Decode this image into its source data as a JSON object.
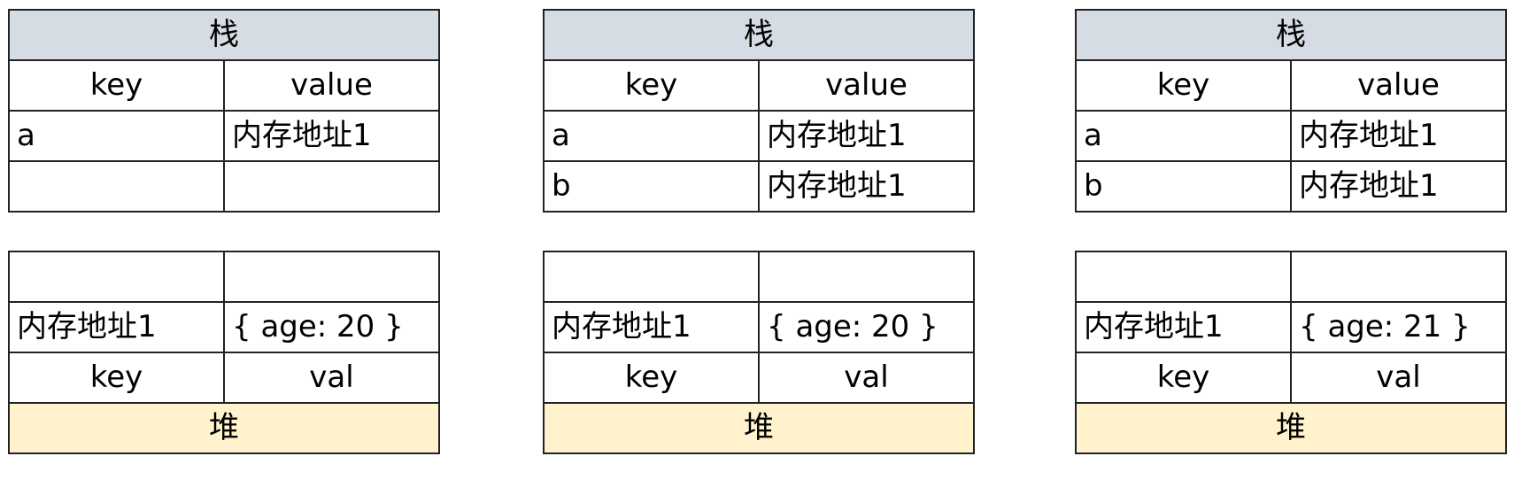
{
  "panels": [
    {
      "stack": {
        "title": "栈",
        "headers": [
          "key",
          "value"
        ],
        "rows": [
          [
            "a",
            "内存地址1"
          ],
          [
            "",
            ""
          ]
        ]
      },
      "heap": {
        "title": "堆",
        "headers": [
          "key",
          "val"
        ],
        "rows": [
          [
            "",
            ""
          ],
          [
            "内存地址1",
            "{ age: 20 }"
          ]
        ]
      }
    },
    {
      "stack": {
        "title": "栈",
        "headers": [
          "key",
          "value"
        ],
        "rows": [
          [
            "a",
            "内存地址1"
          ],
          [
            "b",
            "内存地址1"
          ]
        ]
      },
      "heap": {
        "title": "堆",
        "headers": [
          "key",
          "val"
        ],
        "rows": [
          [
            "",
            ""
          ],
          [
            "内存地址1",
            "{ age: 20 }"
          ]
        ]
      }
    },
    {
      "stack": {
        "title": "栈",
        "headers": [
          "key",
          "value"
        ],
        "rows": [
          [
            "a",
            "内存地址1"
          ],
          [
            "b",
            "内存地址1"
          ]
        ]
      },
      "heap": {
        "title": "堆",
        "headers": [
          "key",
          "val"
        ],
        "rows": [
          [
            "",
            ""
          ],
          [
            "内存地址1",
            "{ age: 21 }"
          ]
        ]
      }
    }
  ],
  "colors": {
    "stack_header": "#d6dce4",
    "heap_header": "#fff2cc",
    "border": "#222222"
  }
}
